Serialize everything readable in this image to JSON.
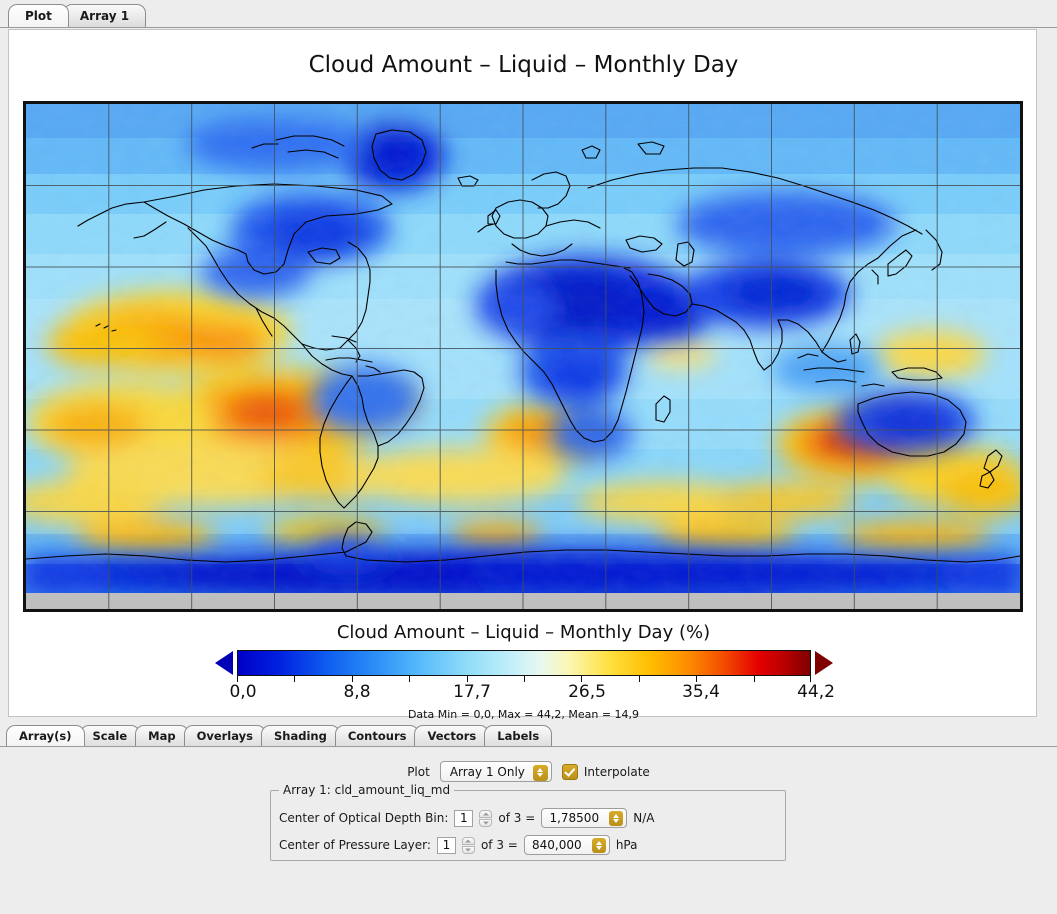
{
  "window": {
    "top_tabs": [
      {
        "label": "Plot",
        "active": true
      },
      {
        "label": "Array 1",
        "active": false
      }
    ]
  },
  "plot": {
    "title": "Cloud Amount – Liquid – Monthly Day",
    "colorbar_title": "Cloud Amount – Liquid – Monthly Day (%)",
    "stats": "Data Min = 0,0, Max = 44,2, Mean = 14,9"
  },
  "chart_data": {
    "type": "heatmap",
    "title": "Cloud Amount – Liquid – Monthly Day",
    "colorbar_title": "Cloud Amount – Liquid – Monthly Day (%)",
    "variable": "cld_amount_liq_md",
    "units": "%",
    "projection": "cylindrical-equidistant world map",
    "xlabel": "",
    "ylabel": "",
    "xlim": [
      -180,
      180
    ],
    "ylim": [
      -90,
      90
    ],
    "grid": true,
    "grid_spacing_deg": 30,
    "legend_position": "bottom",
    "colorbar": {
      "min": 0.0,
      "max": 44.2,
      "tick_labels": [
        "0,0",
        "8,8",
        "17,7",
        "26,5",
        "35,4",
        "44,2"
      ],
      "tick_values": [
        0.0,
        8.8,
        17.7,
        26.5,
        35.4,
        44.2
      ],
      "extend": "both",
      "colors": [
        "#0000c8",
        "#1060f0",
        "#5fc0fb",
        "#bdeefa",
        "#e8f8f0",
        "#ffe040",
        "#ffbe00",
        "#f34b00",
        "#e40000",
        "#7e0000"
      ]
    },
    "data_min": 0.0,
    "data_max": 44.2,
    "data_mean": 14.9,
    "stats_text": "Data Min = 0,0, Max = 44,2, Mean = 14,9",
    "missing_color": "#bfbfbf",
    "notes": "Global liquid cloud amount field: high values (orange/red, 30-44%) over subtropical marine stratocumulus decks off Peru/Chile, Namibia, California and the equatorial east Pacific; low values (dark blue, 0-8%) over Sahara, Arabia, Greenland, Tibet and Antarctica."
  },
  "bottom_tabs": [
    {
      "label": "Array(s)",
      "active": true
    },
    {
      "label": "Scale",
      "active": false
    },
    {
      "label": "Map",
      "active": false
    },
    {
      "label": "Overlays",
      "active": false
    },
    {
      "label": "Shading",
      "active": false
    },
    {
      "label": "Contours",
      "active": false
    },
    {
      "label": "Vectors",
      "active": false
    },
    {
      "label": "Labels",
      "active": false
    }
  ],
  "options": {
    "plot_label": "Plot",
    "plot_mode": "Array 1 Only",
    "interpolate_label": "Interpolate",
    "interpolate_checked": true,
    "group_legend": "Array 1: cld_amount_liq_md",
    "rows": [
      {
        "label": "Center of Optical Depth Bin:",
        "index": "1",
        "of_text": "of 3 =",
        "value": "1,78500",
        "unit": "N/A"
      },
      {
        "label": "Center of Pressure Layer:",
        "index": "1",
        "of_text": "of 3 =",
        "value": "840,000",
        "unit": "hPa"
      }
    ]
  }
}
